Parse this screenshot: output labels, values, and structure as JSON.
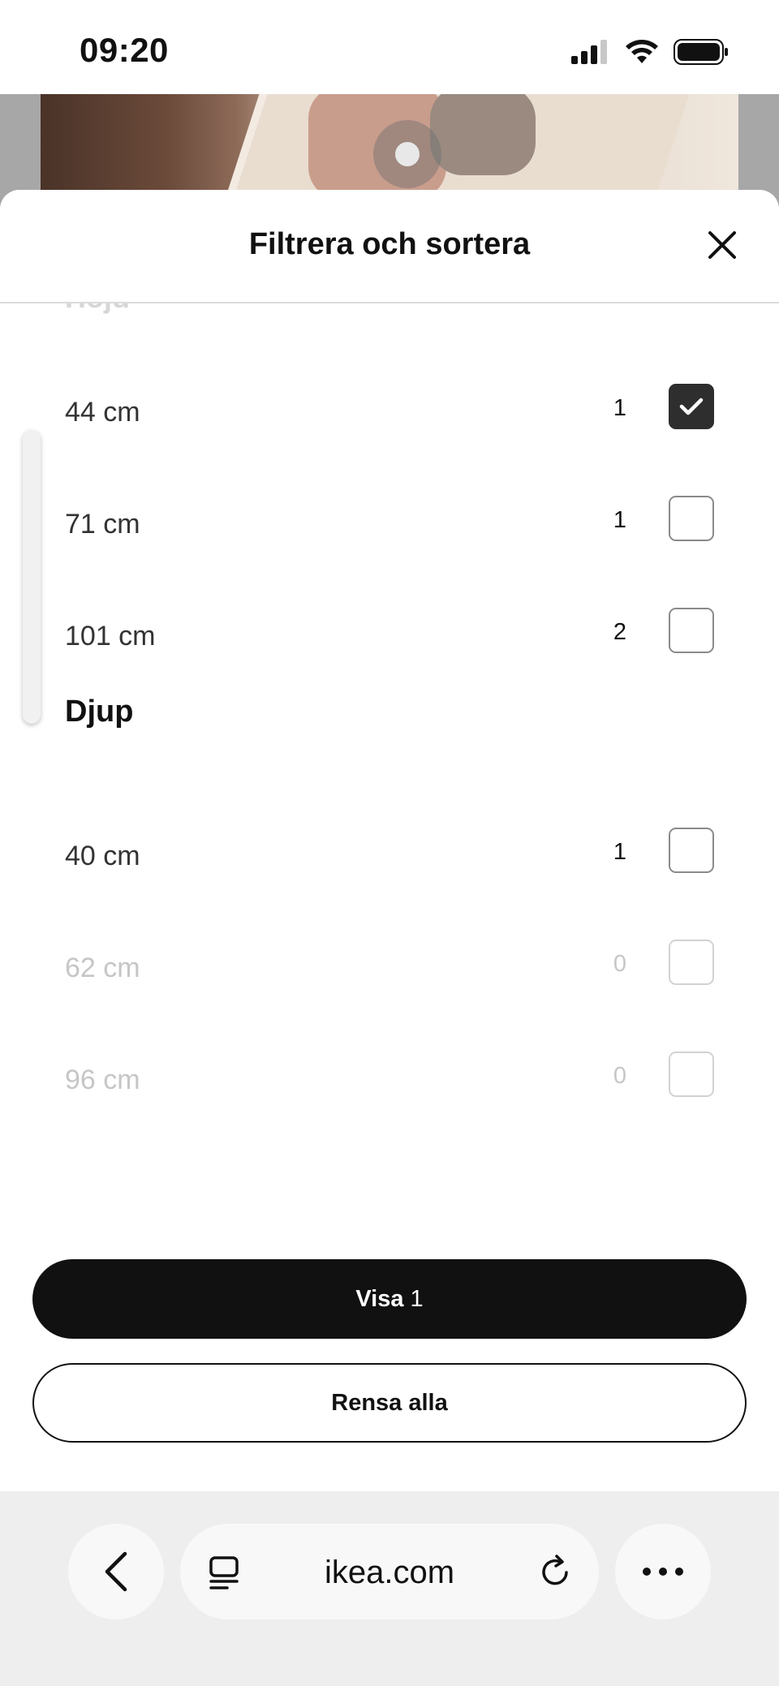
{
  "status_bar": {
    "time": "09:20"
  },
  "sheet": {
    "title": "Filtrera och sortera",
    "cut_section_heading": "Höjd",
    "sections": [
      {
        "heading": "",
        "options": [
          {
            "label": "44 cm",
            "count": "1",
            "checked": true,
            "disabled": false
          },
          {
            "label": "71 cm",
            "count": "1",
            "checked": false,
            "disabled": false
          },
          {
            "label": "101 cm",
            "count": "2",
            "checked": false,
            "disabled": false
          }
        ]
      },
      {
        "heading": "Djup",
        "options": [
          {
            "label": "40 cm",
            "count": "1",
            "checked": false,
            "disabled": false
          },
          {
            "label": "62 cm",
            "count": "0",
            "checked": false,
            "disabled": true
          },
          {
            "label": "96 cm",
            "count": "0",
            "checked": false,
            "disabled": true
          }
        ]
      }
    ],
    "primary_button": {
      "label": "Visa",
      "count": "1"
    },
    "secondary_button": {
      "label": "Rensa alla"
    }
  },
  "browser": {
    "url": "ikea.com"
  },
  "icons": {
    "close": "close-icon",
    "check": "checkmark-icon",
    "back": "chevron-left-icon",
    "reader": "reader-mode-icon",
    "reload": "reload-icon",
    "more": "more-icon",
    "signal": "cellular-signal-icon",
    "wifi": "wifi-icon",
    "battery": "battery-icon"
  }
}
